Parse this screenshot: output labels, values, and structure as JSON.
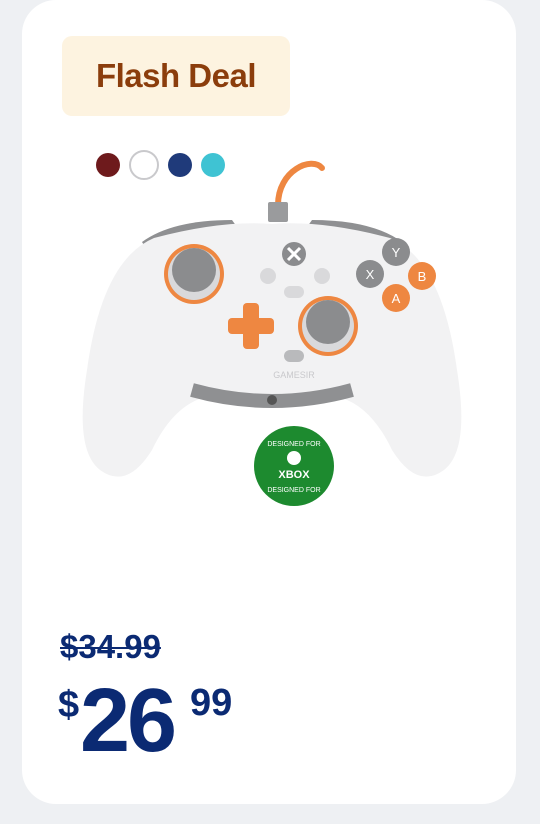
{
  "badge": {
    "label": "Flash Deal"
  },
  "swatches": [
    {
      "name": "maroon",
      "color": "#6e1a1c",
      "selected": false
    },
    {
      "name": "white",
      "color": "#ffffff",
      "selected": true
    },
    {
      "name": "navy",
      "color": "#1f3a7a",
      "selected": false
    },
    {
      "name": "teal",
      "color": "#3fc3d3",
      "selected": false
    }
  ],
  "product": {
    "brand": "GAMESIR",
    "buttons": {
      "y": "Y",
      "x": "X",
      "b": "B",
      "a": "A"
    },
    "logo": {
      "top": "DESIGNED FOR",
      "center": "XBOX",
      "bottom": "DESIGNED FOR"
    },
    "colors": {
      "body": "#f2f2f3",
      "accent": "#ee8741",
      "stick": "#8b8c8e",
      "xbox_green": "#1d8a2f"
    }
  },
  "pricing": {
    "original": "$34.99",
    "currency_symbol": "$",
    "dollars": "26",
    "cents": "99"
  }
}
